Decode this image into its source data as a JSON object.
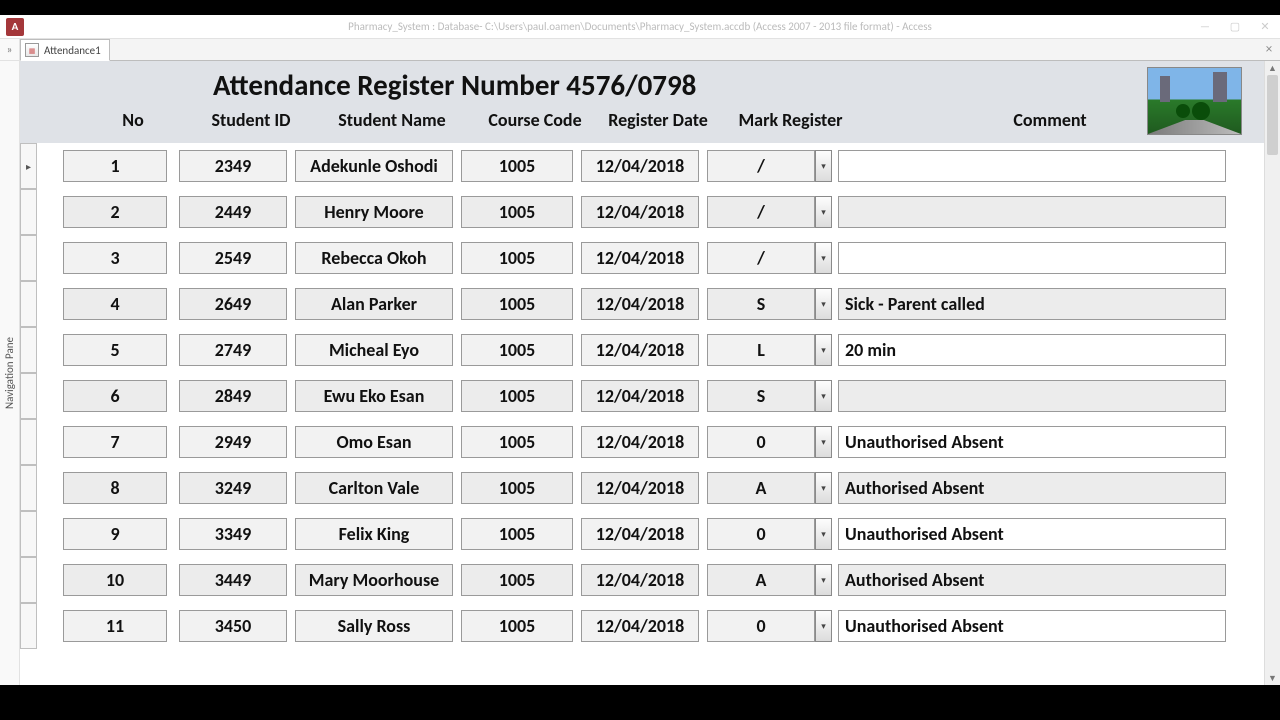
{
  "window": {
    "title": "Pharmacy_System : Database- C:\\Users\\paul.oamen\\Documents\\Pharmacy_System.accdb (Access 2007 - 2013 file format) - Access",
    "app_letter": "A"
  },
  "tab": {
    "label": "Attendance1"
  },
  "nav_pane_label": "Navigation Pane",
  "ribbon_collapse_glyph": "»",
  "form": {
    "title": "Attendance Register Number 4576/0798",
    "headers": {
      "no": "No",
      "student_id": "Student ID",
      "student_name": "Student Name",
      "course_code": "Course Code",
      "register_date": "Register Date",
      "mark_register": "Mark Register",
      "comment": "Comment"
    }
  },
  "rows": [
    {
      "no": "1",
      "student_id": "2349",
      "student_name": "Adekunle Oshodi",
      "course_code": "1005",
      "register_date": "12/04/2018",
      "mark": "/",
      "comment": "",
      "current": true
    },
    {
      "no": "2",
      "student_id": "2449",
      "student_name": "Henry Moore",
      "course_code": "1005",
      "register_date": "12/04/2018",
      "mark": "/",
      "comment": ""
    },
    {
      "no": "3",
      "student_id": "2549",
      "student_name": "Rebecca Okoh",
      "course_code": "1005",
      "register_date": "12/04/2018",
      "mark": "/",
      "comment": ""
    },
    {
      "no": "4",
      "student_id": "2649",
      "student_name": "Alan Parker",
      "course_code": "1005",
      "register_date": "12/04/2018",
      "mark": "S",
      "comment": "Sick - Parent called"
    },
    {
      "no": "5",
      "student_id": "2749",
      "student_name": "Micheal Eyo",
      "course_code": "1005",
      "register_date": "12/04/2018",
      "mark": "L",
      "comment": "20 min"
    },
    {
      "no": "6",
      "student_id": "2849",
      "student_name": "Ewu Eko Esan",
      "course_code": "1005",
      "register_date": "12/04/2018",
      "mark": "S",
      "comment": ""
    },
    {
      "no": "7",
      "student_id": "2949",
      "student_name": "Omo Esan",
      "course_code": "1005",
      "register_date": "12/04/2018",
      "mark": "0",
      "comment": "Unauthorised Absent"
    },
    {
      "no": "8",
      "student_id": "3249",
      "student_name": "Carlton Vale",
      "course_code": "1005",
      "register_date": "12/04/2018",
      "mark": "A",
      "comment": "Authorised Absent"
    },
    {
      "no": "9",
      "student_id": "3349",
      "student_name": "Felix King",
      "course_code": "1005",
      "register_date": "12/04/2018",
      "mark": "0",
      "comment": "Unauthorised Absent"
    },
    {
      "no": "10",
      "student_id": "3449",
      "student_name": "Mary Moorhouse",
      "course_code": "1005",
      "register_date": "12/04/2018",
      "mark": "A",
      "comment": "Authorised Absent"
    },
    {
      "no": "11",
      "student_id": "3450",
      "student_name": "Sally Ross",
      "course_code": "1005",
      "register_date": "12/04/2018",
      "mark": "0",
      "comment": "Unauthorised Absent"
    }
  ]
}
